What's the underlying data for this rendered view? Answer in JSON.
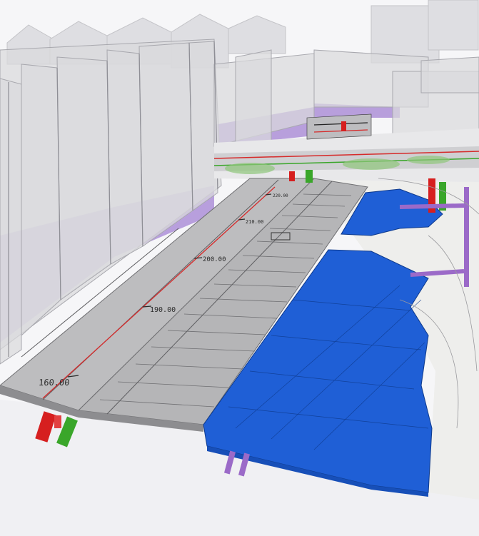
{
  "scene": {
    "description_text": "",
    "colors": {
      "background": "#f6f6f8",
      "road": "#b9b9bb",
      "road_dark": "#a9a9ab",
      "sidewalk": "#c8c8ca",
      "water": "#1f5fd6",
      "water_dark": "#174fb8",
      "building_glass": "#d9d9dd",
      "building_purple": "#a98ad6",
      "pipe_red": "#d61f1f",
      "pipe_green": "#3aa62a",
      "pipe_purple": "#9b6ac8",
      "centerline": "#d62a2a"
    },
    "chainage": [
      {
        "label": "160.00"
      },
      {
        "label": "190.00"
      },
      {
        "label": "200.00"
      },
      {
        "label": "210.00"
      },
      {
        "label": "220.00"
      }
    ],
    "icons": [
      "road-marking-icon"
    ]
  }
}
